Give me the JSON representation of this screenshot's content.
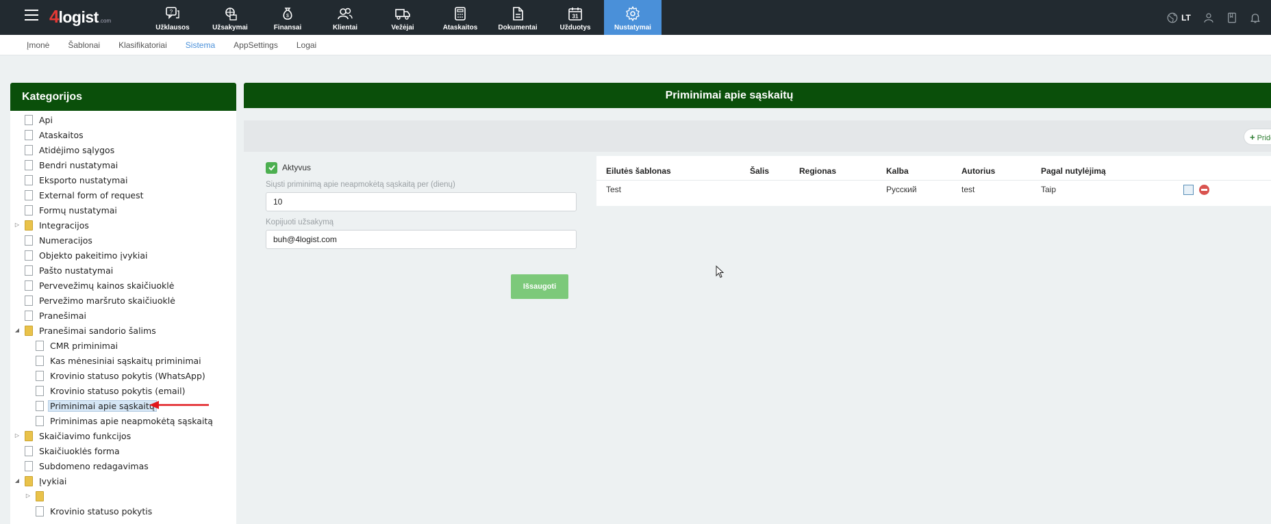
{
  "app": {
    "logo_main": "4",
    "logo_text": "logist",
    "logo_suffix": ".com"
  },
  "nav": [
    {
      "label": "Užklausos",
      "icon": "inquiries-icon"
    },
    {
      "label": "Užsakymai",
      "icon": "orders-icon"
    },
    {
      "label": "Finansai",
      "icon": "money-bag-icon"
    },
    {
      "label": "Klientai",
      "icon": "clients-icon"
    },
    {
      "label": "Vežėjai",
      "icon": "truck-icon"
    },
    {
      "label": "Ataskaitos",
      "icon": "calculator-icon"
    },
    {
      "label": "Dokumentai",
      "icon": "document-icon"
    },
    {
      "label": "Užduotys",
      "icon": "calendar-icon"
    },
    {
      "label": "Nustatymai",
      "icon": "gear-icon"
    }
  ],
  "topright": {
    "language": "LT"
  },
  "subnav": [
    "Įmonė",
    "Šablonai",
    "Klasifikatoriai",
    "Sistema",
    "AppSettings",
    "Logai"
  ],
  "categories": {
    "title": "Kategorijos",
    "items": [
      {
        "label": "Api",
        "level": 0,
        "type": "doc"
      },
      {
        "label": "Ataskaitos",
        "level": 0,
        "type": "doc"
      },
      {
        "label": "Atidėjimo sąlygos",
        "level": 0,
        "type": "doc"
      },
      {
        "label": "Bendri nustatymai",
        "level": 0,
        "type": "doc"
      },
      {
        "label": "Eksporto nustatymai",
        "level": 0,
        "type": "doc"
      },
      {
        "label": "External form of request",
        "level": 0,
        "type": "doc"
      },
      {
        "label": "Formų nustatymai",
        "level": 0,
        "type": "doc"
      },
      {
        "label": "Integracijos",
        "level": 0,
        "type": "folder",
        "state": "collapsed"
      },
      {
        "label": "Numeracijos",
        "level": 0,
        "type": "doc"
      },
      {
        "label": "Objekto pakeitimo įvykiai",
        "level": 0,
        "type": "doc"
      },
      {
        "label": "Pašto nustatymai",
        "level": 0,
        "type": "doc"
      },
      {
        "label": "Pervevežimų kainos skaičiuoklė",
        "level": 0,
        "type": "doc"
      },
      {
        "label": "Pervežimo maršruto skaičiuoklė",
        "level": 0,
        "type": "doc"
      },
      {
        "label": "Pranešimai",
        "level": 0,
        "type": "doc"
      },
      {
        "label": "Pranešimai sandorio šalims",
        "level": 0,
        "type": "folder",
        "state": "expanded"
      },
      {
        "label": "CMR priminimai",
        "level": 1,
        "type": "doc"
      },
      {
        "label": "Kas mėnesiniai sąskaitų priminimai",
        "level": 1,
        "type": "doc"
      },
      {
        "label": "Krovinio statuso pokytis (WhatsApp)",
        "level": 1,
        "type": "doc"
      },
      {
        "label": "Krovinio statuso pokytis (email)",
        "level": 1,
        "type": "doc"
      },
      {
        "label": "Priminimai apie sąskaitų",
        "level": 1,
        "type": "doc",
        "selected": true
      },
      {
        "label": "Priminimas apie neapmokėtą sąskaitą",
        "level": 1,
        "type": "doc"
      },
      {
        "label": "Skaičiavimo funkcijos",
        "level": 0,
        "type": "folder",
        "state": "collapsed"
      },
      {
        "label": "Skaičiuoklės forma",
        "level": 0,
        "type": "doc"
      },
      {
        "label": "Subdomeno redagavimas",
        "level": 0,
        "type": "doc"
      },
      {
        "label": "Įvykiai",
        "level": 0,
        "type": "folder",
        "state": "expanded"
      },
      {
        "label": "",
        "level": 1,
        "type": "folder",
        "state": "collapsed"
      },
      {
        "label": "Krovinio statuso pokytis",
        "level": 1,
        "type": "doc"
      }
    ]
  },
  "main": {
    "title": "Priminimai apie sąskaitų",
    "add_label": "Pridėti",
    "form": {
      "active_label": "Aktyvus",
      "active": true,
      "days_label": "Siųsti priminimą apie neapmokėtą sąskaitą per (dienų)",
      "days_value": "10",
      "copy_label": "Kopijuoti užsakymą",
      "copy_value": "buh@4logist.com",
      "save_label": "Išsaugoti"
    },
    "table": {
      "headers": [
        "Eilutės šablonas",
        "Šalis",
        "Regionas",
        "Kalba",
        "Autorius",
        "Pagal nutylėjimą"
      ],
      "rows": [
        {
          "template": "Test",
          "country": "",
          "region": "",
          "language": "Русский",
          "author": "test",
          "default": "Taip"
        }
      ]
    }
  }
}
